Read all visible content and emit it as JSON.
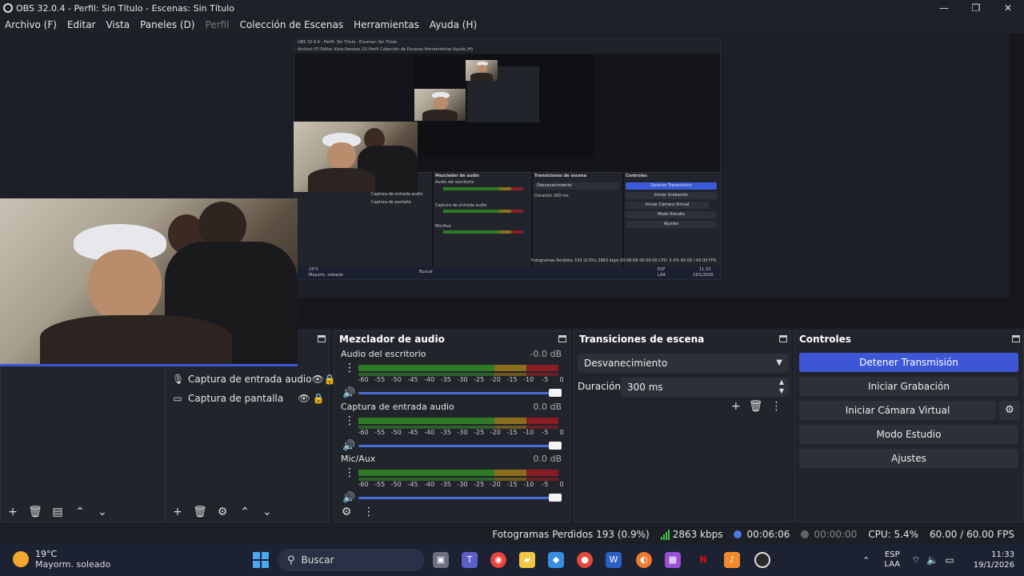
{
  "window": {
    "title": "OBS 32.0.4 - Perfil: Sin Título - Escenas: Sin Título",
    "minimize": "—",
    "maximize": "❐",
    "close": "✕"
  },
  "menu": [
    "Archivo (F)",
    "Editar",
    "Vista",
    "Paneles (D)",
    "Perfil",
    "Colección de Escenas",
    "Herramientas",
    "Ayuda (H)"
  ],
  "preview": {
    "nested": {
      "title": "OBS 32.0.4 - Perfil: Sin Título - Escenas: Sin Título",
      "menu": "Archivo (F)   Editar   Vista   Paneles (D)   Perfil   Colección de Escenas   Herramientas   Ayuda (H)",
      "mixer_title": "Mezclador de audio",
      "trans_title": "Transiciones de escena",
      "controls_title": "Controles",
      "src1": "Captura de entrada audio",
      "src2": "Captura de pantalla",
      "ch1": "Audio del escritorio",
      "ch2": "Captura de entrada audio",
      "ch3": "Mic/Aux",
      "trans_select": "Desvanecimiento",
      "trans_dur_label": "Duración",
      "trans_dur": "300 ms",
      "btn1": "Detener Transmisión",
      "btn2": "Iniciar Grabación",
      "btn3": "Iniciar Cámara Virtual",
      "btn4": "Modo Estudio",
      "btn5": "Ajustes",
      "status": "Fotogramas Perdidos 193 (0.9%)   2863 kbps   00:06:06   00:00:00   CPU: 5.4%   60.00 / 60.00 FPS",
      "weather_temp": "19°C",
      "weather_desc": "Mayorm. soleado",
      "search": "Buscar",
      "lang1": "ESP",
      "lang2": "LAA",
      "time": "11:33",
      "date": "19/1/2026"
    }
  },
  "sources": {
    "items": [
      {
        "label": "Captura de entrada audio",
        "icon": "microphone-icon"
      },
      {
        "label": "Captura de pantalla",
        "icon": "monitor-icon"
      }
    ]
  },
  "mixer": {
    "title": "Mezclador de audio",
    "ticks": [
      "-60",
      "-55",
      "-50",
      "-45",
      "-40",
      "-35",
      "-30",
      "-25",
      "-20",
      "-15",
      "-10",
      "-5",
      "0"
    ],
    "channels": [
      {
        "name": "Audio del escritorio",
        "db": "-0.0 dB"
      },
      {
        "name": "Captura de entrada audio",
        "db": "0.0 dB"
      },
      {
        "name": "Mic/Aux",
        "db": "0.0 dB"
      }
    ]
  },
  "transitions": {
    "title": "Transiciones de escena",
    "selected": "Desvanecimiento",
    "duration_label": "Duración",
    "duration": "300 ms"
  },
  "controls": {
    "title": "Controles",
    "stop_stream": "Detener Transmisión",
    "start_recording": "Iniciar Grabación",
    "start_virtual_cam": "Iniciar Cámara Virtual",
    "studio_mode": "Modo Estudio",
    "settings": "Ajustes"
  },
  "status": {
    "dropped_frames": "Fotogramas Perdidos 193 (0.9%)",
    "bitrate": "2863 kbps",
    "stream_time": "00:06:06",
    "record_time": "00:00:00",
    "cpu": "CPU: 5.4%",
    "fps": "60.00 / 60.00 FPS"
  },
  "taskbar": {
    "weather_temp": "19°C",
    "weather_desc": "Mayorm. soleado",
    "search_placeholder": "Buscar",
    "lang_line1": "ESP",
    "lang_line2": "LAA",
    "time": "11:33",
    "date": "19/1/2026"
  },
  "colors": {
    "accent": "#3d56d6",
    "panel": "#22242c",
    "background": "#1d1f26",
    "meter_green": "#2f7a26",
    "meter_yellow": "#8a6e1c",
    "meter_red": "#8a1c24"
  }
}
